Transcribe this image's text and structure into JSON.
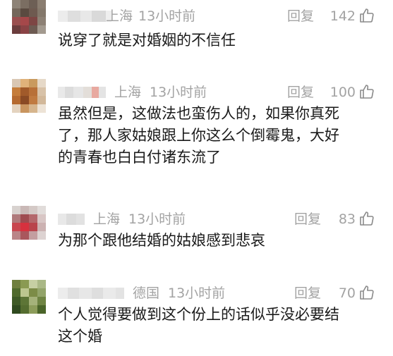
{
  "comments": [
    {
      "location": "上海",
      "time": "13小时前",
      "reply_label": "回复",
      "likes": "142",
      "text_lines": [
        "说穿了就是对婚姻的不信任"
      ]
    },
    {
      "location": "上海",
      "time": "13小时前",
      "reply_label": "回复",
      "likes": "100",
      "text_lines": [
        "虽然但是，这做法也蛮伤人的，如果你真死",
        "了，那人家姑娘跟上你这么个倒霉鬼，大好",
        "的青春也白白付诸东流了"
      ]
    },
    {
      "location": "上海",
      "time": "13小时前",
      "reply_label": "回复",
      "likes": "83",
      "text_lines": [
        "为那个跟他结婚的姑娘感到悲哀"
      ]
    },
    {
      "location": "德国",
      "time": "13小时前",
      "reply_label": "回复",
      "likes": "70",
      "text_lines": [
        "个人觉得要做到这个份上的话似乎没必要结",
        "这个婚"
      ]
    }
  ],
  "icons": {
    "like": "thumbs-up-icon"
  },
  "colors": {
    "meta": "#a3a3a3",
    "text": "#1a1a1a"
  }
}
